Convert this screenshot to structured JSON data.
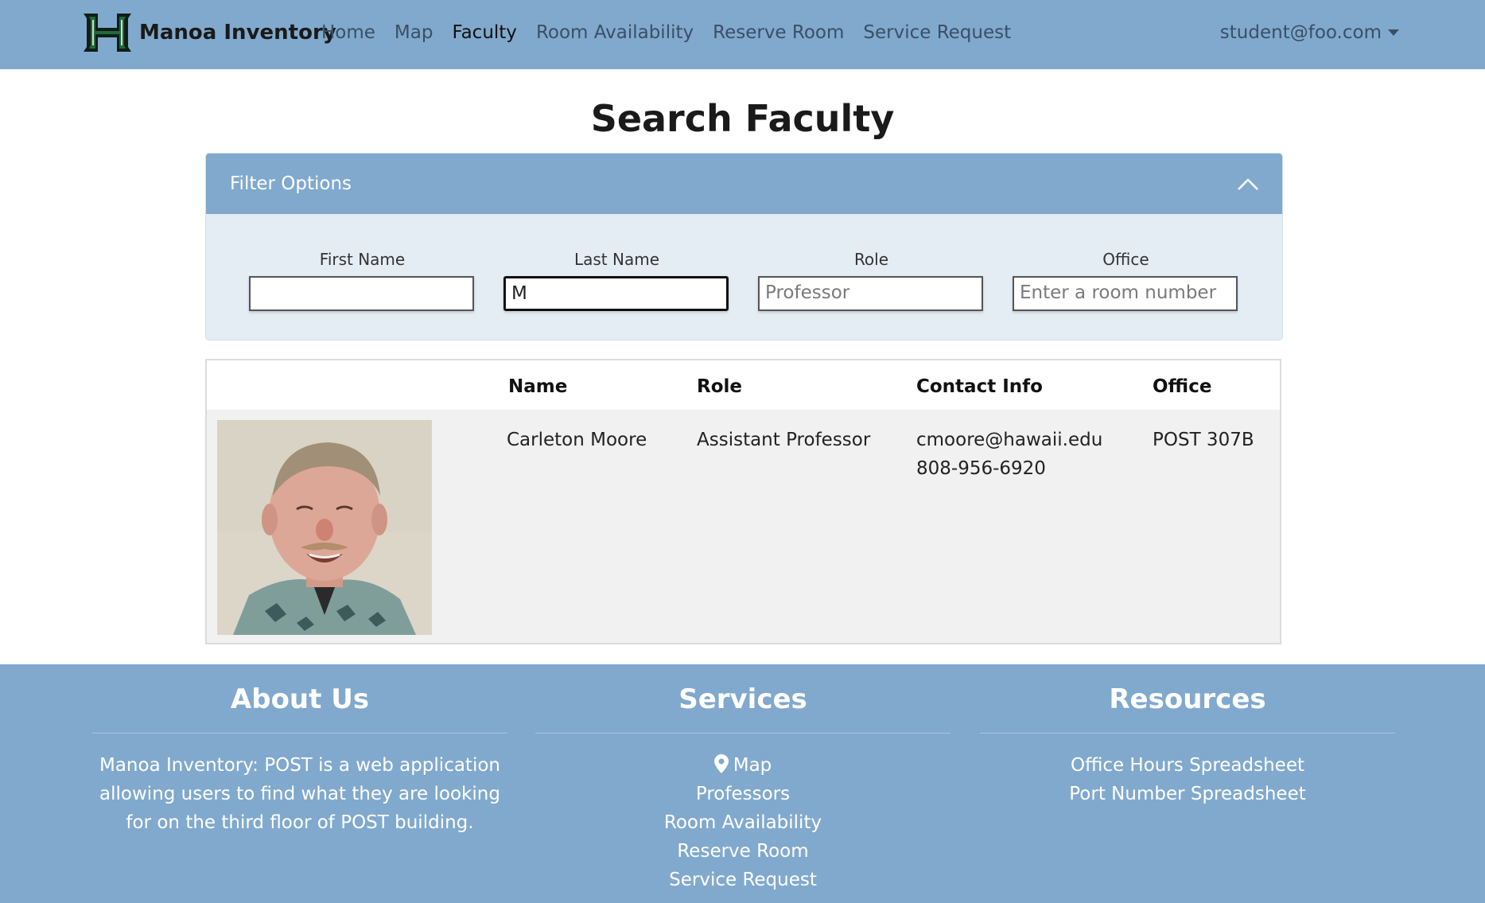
{
  "navbar": {
    "brand": "Manoa Inventory",
    "items": [
      {
        "label": "Home"
      },
      {
        "label": "Map"
      },
      {
        "label": "Faculty",
        "active": true
      },
      {
        "label": "Room Availability"
      },
      {
        "label": "Reserve Room"
      },
      {
        "label": "Service Request"
      }
    ],
    "user": "student@foo.com"
  },
  "page": {
    "title": "Search Faculty"
  },
  "filter": {
    "title": "Filter Options",
    "fields": [
      {
        "label": "First Name",
        "value": "",
        "placeholder": ""
      },
      {
        "label": "Last Name",
        "value": "M",
        "placeholder": ""
      },
      {
        "label": "Role",
        "value": "",
        "placeholder": "Professor"
      },
      {
        "label": "Office",
        "value": "",
        "placeholder": "Enter a room number"
      }
    ]
  },
  "table": {
    "headers": {
      "name": "Name",
      "role": "Role",
      "contact": "Contact Info",
      "office": "Office"
    },
    "rows": [
      {
        "name": "Carleton Moore",
        "role": "Assistant Professor",
        "email": "cmoore@hawaii.edu",
        "phone": "808-956-6920",
        "office": "POST 307B"
      }
    ]
  },
  "footer": {
    "about": {
      "title": "About Us",
      "text": "Manoa Inventory: POST is a web application allowing users to find what they are looking for on the third floor of POST building."
    },
    "services": {
      "title": "Services",
      "links": [
        "Map",
        "Professors",
        "Room Availability",
        "Reserve Room",
        "Service Request"
      ]
    },
    "resources": {
      "title": "Resources",
      "links": [
        "Office Hours Spreadsheet",
        "Port Number Spreadsheet"
      ]
    }
  },
  "colors": {
    "accent": "#81a9cd",
    "filter_bg": "#e4ecf4",
    "row_bg": "#f1f1f1",
    "logo_green": "#1f6b3a"
  }
}
